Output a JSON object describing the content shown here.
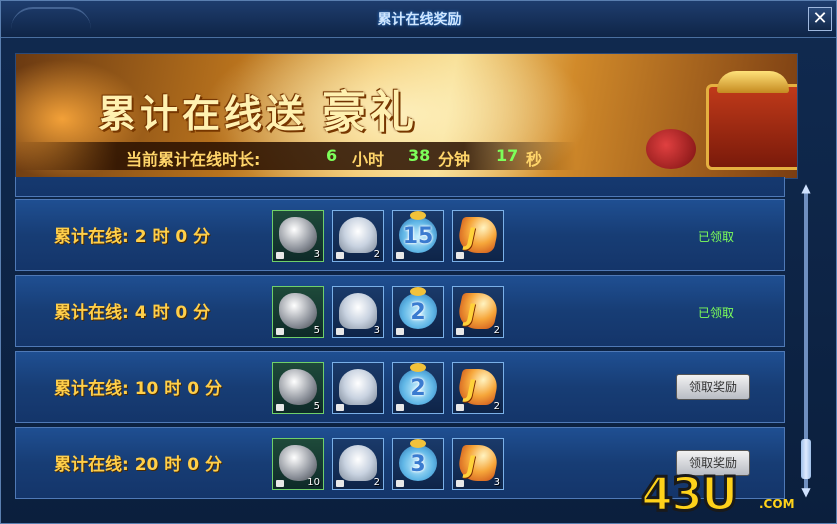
{
  "window": {
    "title": "累计在线奖励",
    "close_label": "✕"
  },
  "banner": {
    "headline_main": "累计在线送",
    "headline_big": "豪礼",
    "time_label": "当前累计在线时长:",
    "hours": "6",
    "hours_unit": "小时",
    "minutes": "38",
    "minutes_unit": "分钟",
    "seconds": "17",
    "seconds_unit": "秒"
  },
  "rows": [
    {
      "label": "累计在线:  2  时  0  分",
      "items": [
        {
          "icon": "stone-icon",
          "count": "3"
        },
        {
          "icon": "silver-ingot-icon",
          "count": "2"
        },
        {
          "icon": "lucky-bag-icon",
          "bag_number": "15",
          "count": ""
        },
        {
          "icon": "flame-j-icon",
          "count": ""
        }
      ],
      "status": "已领取"
    },
    {
      "label": "累计在线:  4  时  0  分",
      "items": [
        {
          "icon": "stone-icon",
          "count": "5"
        },
        {
          "icon": "silver-ingot-icon",
          "count": "3"
        },
        {
          "icon": "lucky-bag-icon",
          "bag_number": "2",
          "count": ""
        },
        {
          "icon": "flame-j-icon",
          "count": "2"
        }
      ],
      "status": "已领取"
    },
    {
      "label": "累计在线:  10  时  0  分",
      "items": [
        {
          "icon": "stone-icon",
          "count": "5"
        },
        {
          "icon": "silver-ingot-icon",
          "count": ""
        },
        {
          "icon": "lucky-bag-icon",
          "bag_number": "2",
          "count": ""
        },
        {
          "icon": "flame-j-icon",
          "count": "2"
        }
      ],
      "button": "领取奖励"
    },
    {
      "label": "累计在线:  20  时  0  分",
      "items": [
        {
          "icon": "stone-icon",
          "count": "10"
        },
        {
          "icon": "silver-ingot-icon",
          "count": "2"
        },
        {
          "icon": "lucky-bag-icon",
          "bag_number": "3",
          "count": ""
        },
        {
          "icon": "flame-j-icon",
          "count": "3"
        }
      ],
      "button": "领取奖励"
    }
  ],
  "watermark": {
    "brand": "43U",
    "suffix": ".COM"
  },
  "colors": {
    "accent_gold": "#ffcf4a",
    "claimed_green": "#7dff5a",
    "panel_blue": "#1f4f92"
  }
}
